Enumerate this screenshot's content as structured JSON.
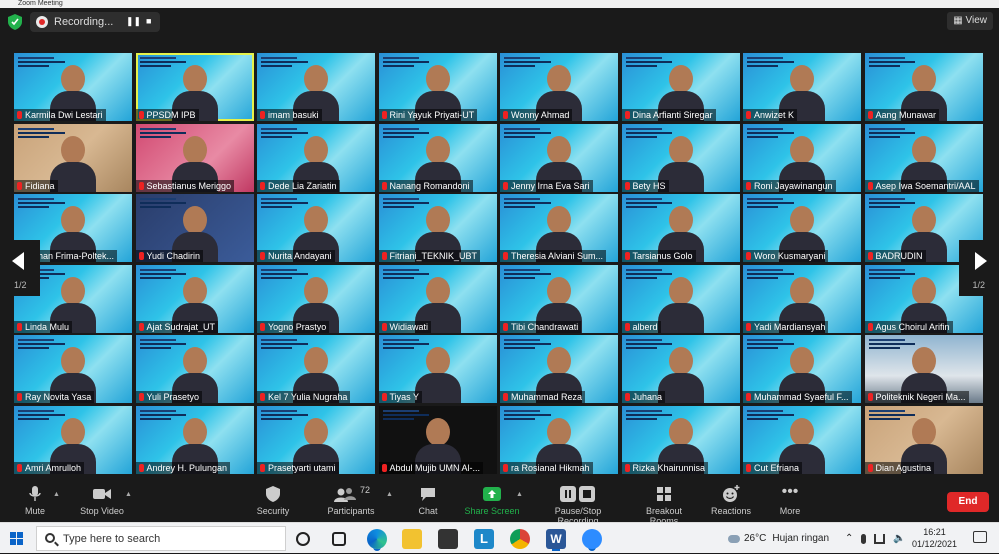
{
  "window": {
    "title": "Zoom Meeting"
  },
  "topbar": {
    "recording_label": "Recording...",
    "view_label": "View"
  },
  "pager": {
    "left_page": "1/2",
    "right_page": "1/2"
  },
  "participants": [
    "Karmila Dwi Lestari",
    "PPSDM IPB",
    "imam basuki",
    "Rini Yayuk Priyati-UT",
    "Wonny Ahmad",
    "Dina Arfianti Siregar",
    "Anwizet K",
    "Aang Munawar",
    "Fidiana",
    "Sebastianus Meriggo",
    "Dede Lia Zariatin",
    "Nanang Romandoni",
    "Jenny Irna Eva Sari",
    "Bety HS",
    "Roni Jayawinangun",
    "Asep Iwa Soemantri/AAL",
    "Rizhan Frima-Poltek...",
    "Yudi Chadirin",
    "Nurita Andayani",
    "Fitriani_TEKNIK_UBT",
    "Theresia Alviani Sum...",
    "Tarsianus Golo",
    "Woro Kusmaryani",
    "BADRUDIN",
    "Linda Mulu",
    "Ajat Sudrajat_UT",
    "Yogno Prastyo",
    "Widiawati",
    "Tibi Chandrawati",
    "alberd",
    "Yadi Mardiansyah",
    "Agus Choirul Arifin",
    "Ray Novita Yasa",
    "Yuli Prasetyo",
    "Kel 7 Yulia Nugraha",
    "Tiyas Y",
    "Muhammad Reza",
    "Juhana",
    "Muhammad Syaeful F...",
    "Politeknik Negeri Ma...",
    "Amri Amrulloh",
    "Andrey H. Pulungan",
    "Prasetyarti utami",
    "Abdul Mujib UMN Al-...",
    "ra Rosianal Hikmah",
    "Rizka Khairunnisa",
    "Cut Efriana",
    "Dian Agustina"
  ],
  "toolbar": {
    "mute": "Mute",
    "stop_video": "Stop Video",
    "security": "Security",
    "participants": "Participants",
    "participants_count": "72",
    "chat": "Chat",
    "share_screen": "Share Screen",
    "recording": "Pause/Stop Recording",
    "breakout": "Breakout Rooms",
    "reactions": "Reactions",
    "more": "More",
    "end": "End"
  },
  "taskbar": {
    "search_placeholder": "Type here to search",
    "weather_temp": "26°C",
    "weather_text": "Hujan ringan",
    "time": "16:21",
    "date": "01/12/2021"
  },
  "colors": {
    "end_red": "#e02828",
    "share_green": "#22b14c",
    "active_outline": "#e6f24a"
  }
}
